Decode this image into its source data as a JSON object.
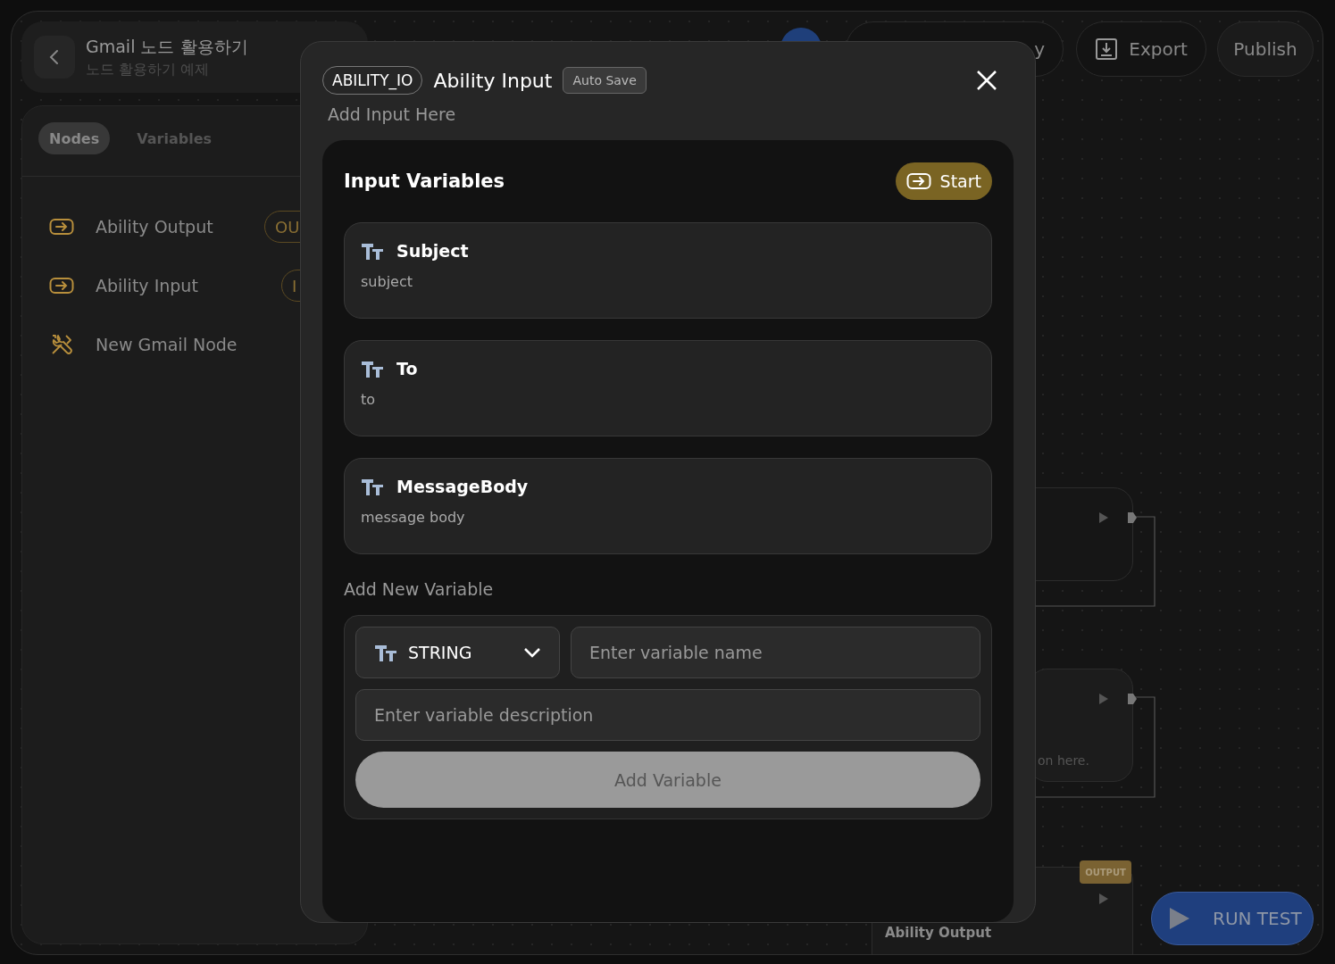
{
  "project": {
    "title": "Gmail 노드 활용하기",
    "subtitle": "노드 활용하기 예제"
  },
  "sidebar": {
    "tabs": [
      {
        "label": "Nodes",
        "selected": true
      },
      {
        "label": "Variables",
        "selected": false
      }
    ],
    "items": [
      {
        "label": "Ability Output",
        "kind": "io",
        "badge": "OU"
      },
      {
        "label": "Ability Input",
        "kind": "io",
        "badge": "I"
      },
      {
        "label": "New Gmail Node",
        "kind": "tool"
      }
    ]
  },
  "toolbar": {
    "history_button": "y",
    "export_button": "Export",
    "publish_button": "Publish"
  },
  "canvas": {
    "nodes": [
      {
        "kind": "blank"
      },
      {
        "kind": "text",
        "text": "on here."
      },
      {
        "kind": "output",
        "badge": "OUTPUT",
        "title": "Ability Output"
      }
    ],
    "run_button": "RUN TEST"
  },
  "modal": {
    "type_tag": "ABILITY_IO",
    "title": "Ability Input",
    "autosave_badge": "Auto Save",
    "description": "Add Input Here",
    "panel_title": "Input Variables",
    "start_button": "Start",
    "variables": [
      {
        "name": "Subject",
        "description": "subject"
      },
      {
        "name": "To",
        "description": "to"
      },
      {
        "name": "MessageBody",
        "description": "message body"
      }
    ],
    "add_section": {
      "title": "Add New Variable",
      "type_select": "STRING",
      "name_field": {
        "placeholder": "Enter variable name"
      },
      "description_field": {
        "placeholder": "Enter variable description"
      },
      "add_button": {
        "label": "Add Variable",
        "disabled": true
      }
    }
  }
}
